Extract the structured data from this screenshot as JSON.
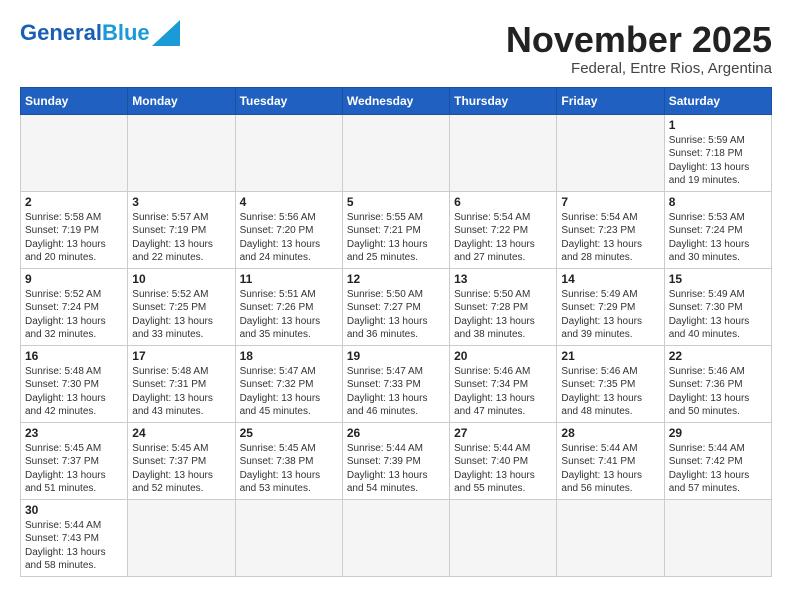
{
  "header": {
    "logo_general": "General",
    "logo_blue": "Blue",
    "title": "November 2025",
    "subtitle": "Federal, Entre Rios, Argentina"
  },
  "days_of_week": [
    "Sunday",
    "Monday",
    "Tuesday",
    "Wednesday",
    "Thursday",
    "Friday",
    "Saturday"
  ],
  "weeks": [
    [
      {
        "day": "",
        "info": ""
      },
      {
        "day": "",
        "info": ""
      },
      {
        "day": "",
        "info": ""
      },
      {
        "day": "",
        "info": ""
      },
      {
        "day": "",
        "info": ""
      },
      {
        "day": "",
        "info": ""
      },
      {
        "day": "1",
        "info": "Sunrise: 5:59 AM\nSunset: 7:18 PM\nDaylight: 13 hours and 19 minutes."
      }
    ],
    [
      {
        "day": "2",
        "info": "Sunrise: 5:58 AM\nSunset: 7:19 PM\nDaylight: 13 hours and 20 minutes."
      },
      {
        "day": "3",
        "info": "Sunrise: 5:57 AM\nSunset: 7:19 PM\nDaylight: 13 hours and 22 minutes."
      },
      {
        "day": "4",
        "info": "Sunrise: 5:56 AM\nSunset: 7:20 PM\nDaylight: 13 hours and 24 minutes."
      },
      {
        "day": "5",
        "info": "Sunrise: 5:55 AM\nSunset: 7:21 PM\nDaylight: 13 hours and 25 minutes."
      },
      {
        "day": "6",
        "info": "Sunrise: 5:54 AM\nSunset: 7:22 PM\nDaylight: 13 hours and 27 minutes."
      },
      {
        "day": "7",
        "info": "Sunrise: 5:54 AM\nSunset: 7:23 PM\nDaylight: 13 hours and 28 minutes."
      },
      {
        "day": "8",
        "info": "Sunrise: 5:53 AM\nSunset: 7:24 PM\nDaylight: 13 hours and 30 minutes."
      }
    ],
    [
      {
        "day": "9",
        "info": "Sunrise: 5:52 AM\nSunset: 7:24 PM\nDaylight: 13 hours and 32 minutes."
      },
      {
        "day": "10",
        "info": "Sunrise: 5:52 AM\nSunset: 7:25 PM\nDaylight: 13 hours and 33 minutes."
      },
      {
        "day": "11",
        "info": "Sunrise: 5:51 AM\nSunset: 7:26 PM\nDaylight: 13 hours and 35 minutes."
      },
      {
        "day": "12",
        "info": "Sunrise: 5:50 AM\nSunset: 7:27 PM\nDaylight: 13 hours and 36 minutes."
      },
      {
        "day": "13",
        "info": "Sunrise: 5:50 AM\nSunset: 7:28 PM\nDaylight: 13 hours and 38 minutes."
      },
      {
        "day": "14",
        "info": "Sunrise: 5:49 AM\nSunset: 7:29 PM\nDaylight: 13 hours and 39 minutes."
      },
      {
        "day": "15",
        "info": "Sunrise: 5:49 AM\nSunset: 7:30 PM\nDaylight: 13 hours and 40 minutes."
      }
    ],
    [
      {
        "day": "16",
        "info": "Sunrise: 5:48 AM\nSunset: 7:30 PM\nDaylight: 13 hours and 42 minutes."
      },
      {
        "day": "17",
        "info": "Sunrise: 5:48 AM\nSunset: 7:31 PM\nDaylight: 13 hours and 43 minutes."
      },
      {
        "day": "18",
        "info": "Sunrise: 5:47 AM\nSunset: 7:32 PM\nDaylight: 13 hours and 45 minutes."
      },
      {
        "day": "19",
        "info": "Sunrise: 5:47 AM\nSunset: 7:33 PM\nDaylight: 13 hours and 46 minutes."
      },
      {
        "day": "20",
        "info": "Sunrise: 5:46 AM\nSunset: 7:34 PM\nDaylight: 13 hours and 47 minutes."
      },
      {
        "day": "21",
        "info": "Sunrise: 5:46 AM\nSunset: 7:35 PM\nDaylight: 13 hours and 48 minutes."
      },
      {
        "day": "22",
        "info": "Sunrise: 5:46 AM\nSunset: 7:36 PM\nDaylight: 13 hours and 50 minutes."
      }
    ],
    [
      {
        "day": "23",
        "info": "Sunrise: 5:45 AM\nSunset: 7:37 PM\nDaylight: 13 hours and 51 minutes."
      },
      {
        "day": "24",
        "info": "Sunrise: 5:45 AM\nSunset: 7:37 PM\nDaylight: 13 hours and 52 minutes."
      },
      {
        "day": "25",
        "info": "Sunrise: 5:45 AM\nSunset: 7:38 PM\nDaylight: 13 hours and 53 minutes."
      },
      {
        "day": "26",
        "info": "Sunrise: 5:44 AM\nSunset: 7:39 PM\nDaylight: 13 hours and 54 minutes."
      },
      {
        "day": "27",
        "info": "Sunrise: 5:44 AM\nSunset: 7:40 PM\nDaylight: 13 hours and 55 minutes."
      },
      {
        "day": "28",
        "info": "Sunrise: 5:44 AM\nSunset: 7:41 PM\nDaylight: 13 hours and 56 minutes."
      },
      {
        "day": "29",
        "info": "Sunrise: 5:44 AM\nSunset: 7:42 PM\nDaylight: 13 hours and 57 minutes."
      }
    ],
    [
      {
        "day": "30",
        "info": "Sunrise: 5:44 AM\nSunset: 7:43 PM\nDaylight: 13 hours and 58 minutes."
      },
      {
        "day": "",
        "info": ""
      },
      {
        "day": "",
        "info": ""
      },
      {
        "day": "",
        "info": ""
      },
      {
        "day": "",
        "info": ""
      },
      {
        "day": "",
        "info": ""
      },
      {
        "day": "",
        "info": ""
      }
    ]
  ]
}
